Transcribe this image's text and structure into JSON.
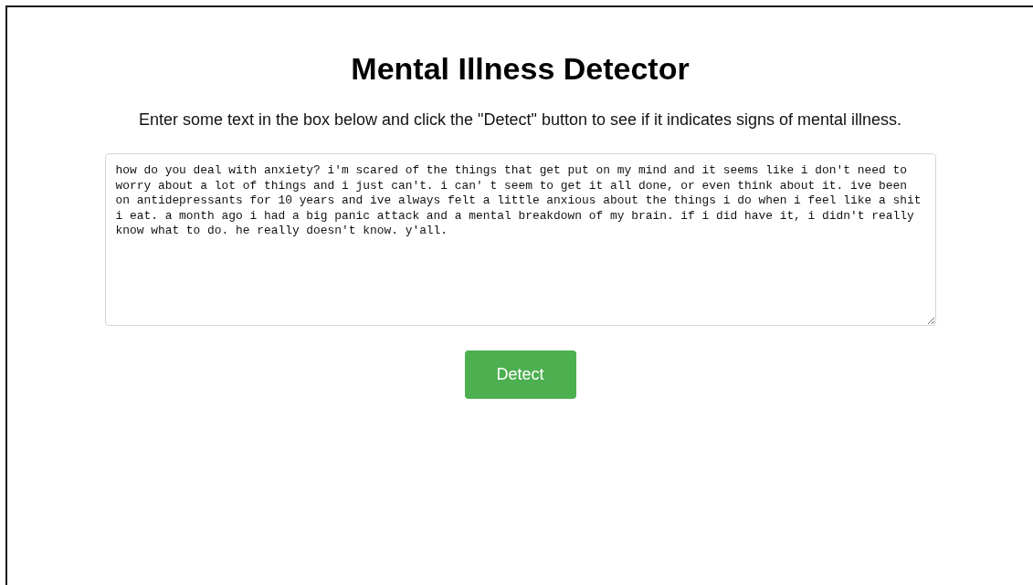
{
  "title": "Mental Illness Detector",
  "instructions": "Enter some text in the box below and click the \"Detect\" button to see if it indicates signs of mental illness.",
  "text_input": {
    "value": "how do you deal with anxiety? i'm scared of the things that get put on my mind and it seems like i don't need to worry about a lot of things and i just can't. i can' t seem to get it all done, or even think about it. ive been on antidepressants for 10 years and ive always felt a little anxious about the things i do when i feel like a shit i eat. a month ago i had a big panic attack and a mental breakdown of my brain. if i did have it, i didn't really know what to do. he really doesn't know. y'all."
  },
  "button": "Detect"
}
